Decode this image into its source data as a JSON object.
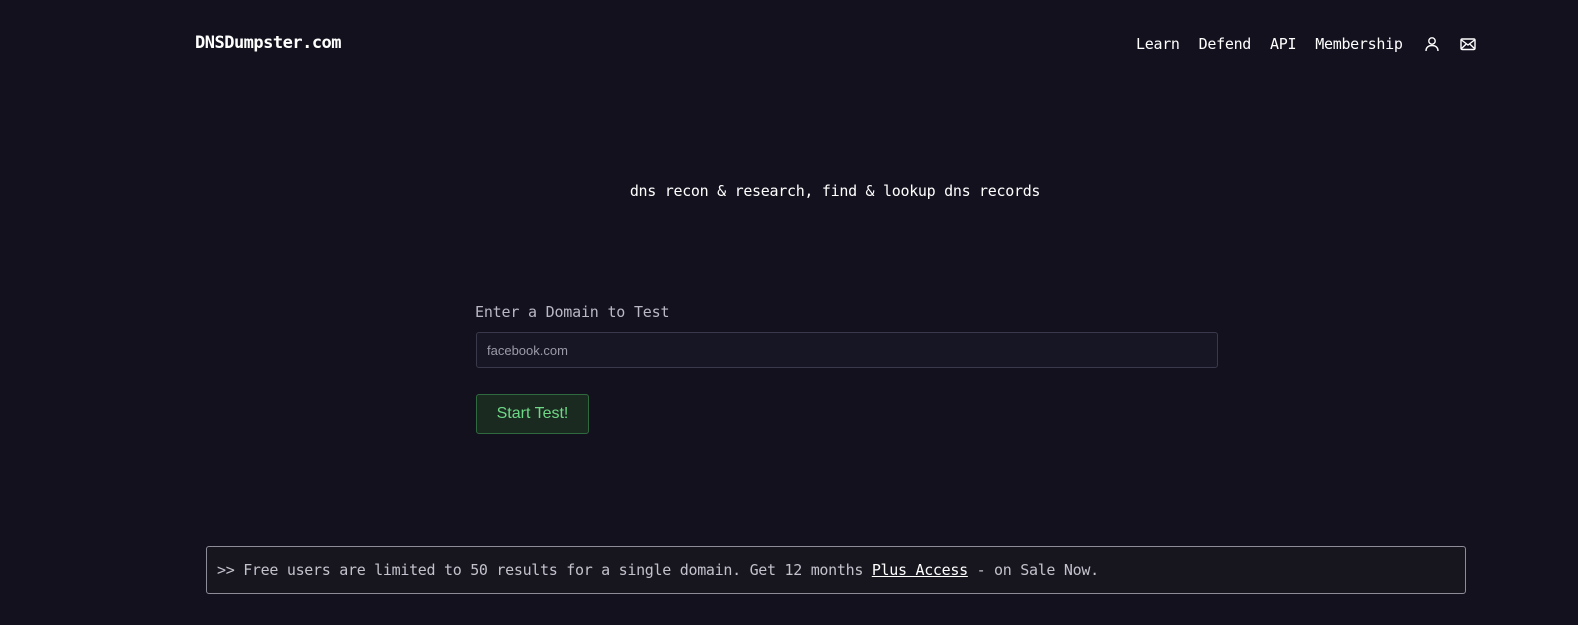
{
  "header": {
    "logo": "DNSDumpster.com",
    "nav": [
      {
        "label": "Learn"
      },
      {
        "label": "Defend"
      },
      {
        "label": "API"
      },
      {
        "label": "Membership"
      }
    ],
    "icons": [
      "user-icon",
      "mail-icon"
    ]
  },
  "hero": {
    "tagline": "dns recon & research, find & lookup dns records"
  },
  "form": {
    "label": "Enter a Domain to Test",
    "placeholder": "facebook.com",
    "submit_label": "Start Test!"
  },
  "notice": {
    "prefix": ">> Free users are limited to 50 results for a single domain. Get 12 months ",
    "link": "Plus Access",
    "suffix": " - on Sale Now."
  },
  "colors": {
    "background": "#12111d",
    "accent_green": "#6ed886"
  }
}
